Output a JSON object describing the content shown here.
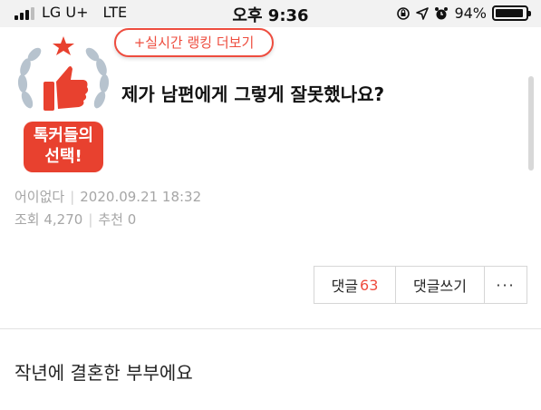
{
  "status_bar": {
    "carrier": "LG U+",
    "network": "LTE",
    "time": "오후 9:36",
    "battery": "94%",
    "battery_level": 0.94
  },
  "ranking_button": {
    "label": "+실시간 랭킹 더보기"
  },
  "badge": {
    "line1": "톡커들의",
    "line2": "선택!"
  },
  "post": {
    "title": "제가 남편에게 그렇게 잘못했나요?",
    "author": "어이없다",
    "date": "2020.09.21 18:32",
    "views_label": "조회 4,270",
    "recommend_label": "추천 0",
    "body_first_line": "작년에 결혼한 부부에요"
  },
  "actions": {
    "comments_label": "댓글",
    "comments_count": "63",
    "write_label": "댓글쓰기",
    "more_label": "···"
  },
  "colors": {
    "accent": "#ee4d3f",
    "badge_red": "#e8412f",
    "laurel": "#b7c3ce"
  }
}
